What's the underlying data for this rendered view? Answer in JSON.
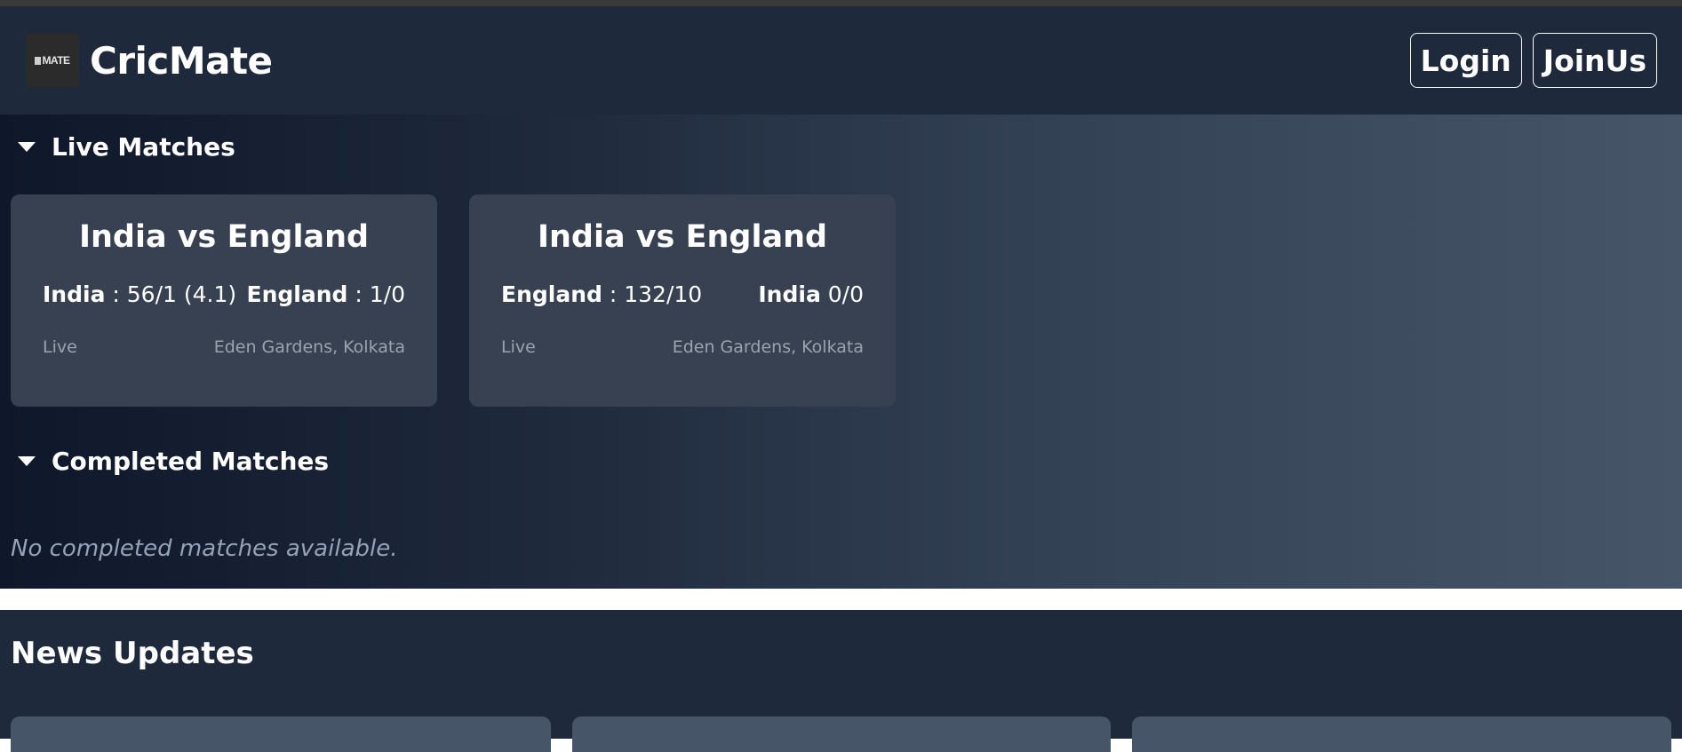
{
  "header": {
    "logo_text": "MATE",
    "brand": "CricMate",
    "login_label": "Login",
    "join_label": "JoinUs"
  },
  "live": {
    "title": "Live Matches",
    "matches": [
      {
        "title": "India vs England",
        "team1": "India",
        "team1_sep": " : ",
        "team1_score": "56/1 (4.1)",
        "team2": "England",
        "team2_sep": " : ",
        "team2_score": "1/0",
        "status": "Live",
        "venue": "Eden Gardens, Kolkata"
      },
      {
        "title": "India vs England",
        "team1": "England",
        "team1_sep": " : ",
        "team1_score": "132/10",
        "team2": "India",
        "team2_sep": " ",
        "team2_score": "0/0",
        "status": "Live",
        "venue": "Eden Gardens, Kolkata"
      }
    ]
  },
  "completed": {
    "title": "Completed Matches",
    "empty_message": "No completed matches available."
  },
  "news": {
    "title": "News Updates"
  }
}
